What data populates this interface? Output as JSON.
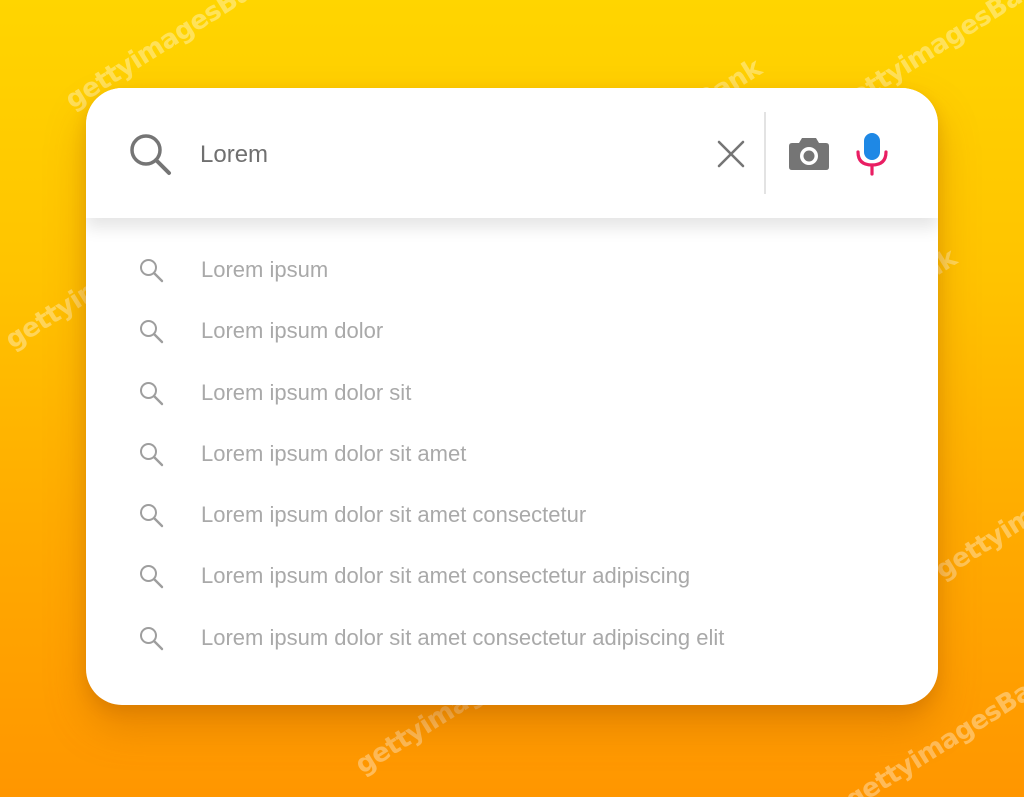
{
  "search": {
    "query": "Lorem"
  },
  "suggestions": [
    {
      "label": "Lorem ipsum"
    },
    {
      "label": "Lorem ipsum dolor"
    },
    {
      "label": "Lorem ipsum dolor sit"
    },
    {
      "label": "Lorem ipsum dolor sit amet"
    },
    {
      "label": "Lorem ipsum dolor sit amet consectetur"
    },
    {
      "label": "Lorem ipsum dolor sit amet consectetur adipiscing"
    },
    {
      "label": "Lorem ipsum dolor sit amet consectetur adipiscing elit"
    }
  ],
  "icons": {
    "search": "search-icon",
    "clear": "close-icon",
    "camera": "camera-icon",
    "microphone": "microphone-icon"
  },
  "colors": {
    "background_top": "#FFD500",
    "background_bottom": "#FF9600",
    "mic_blue": "#1E88E5",
    "mic_pink": "#E91E63",
    "icon_gray": "#757575",
    "suggestion_text": "#a9a9a9"
  },
  "watermark": {
    "text": "gettyimagesBank"
  }
}
